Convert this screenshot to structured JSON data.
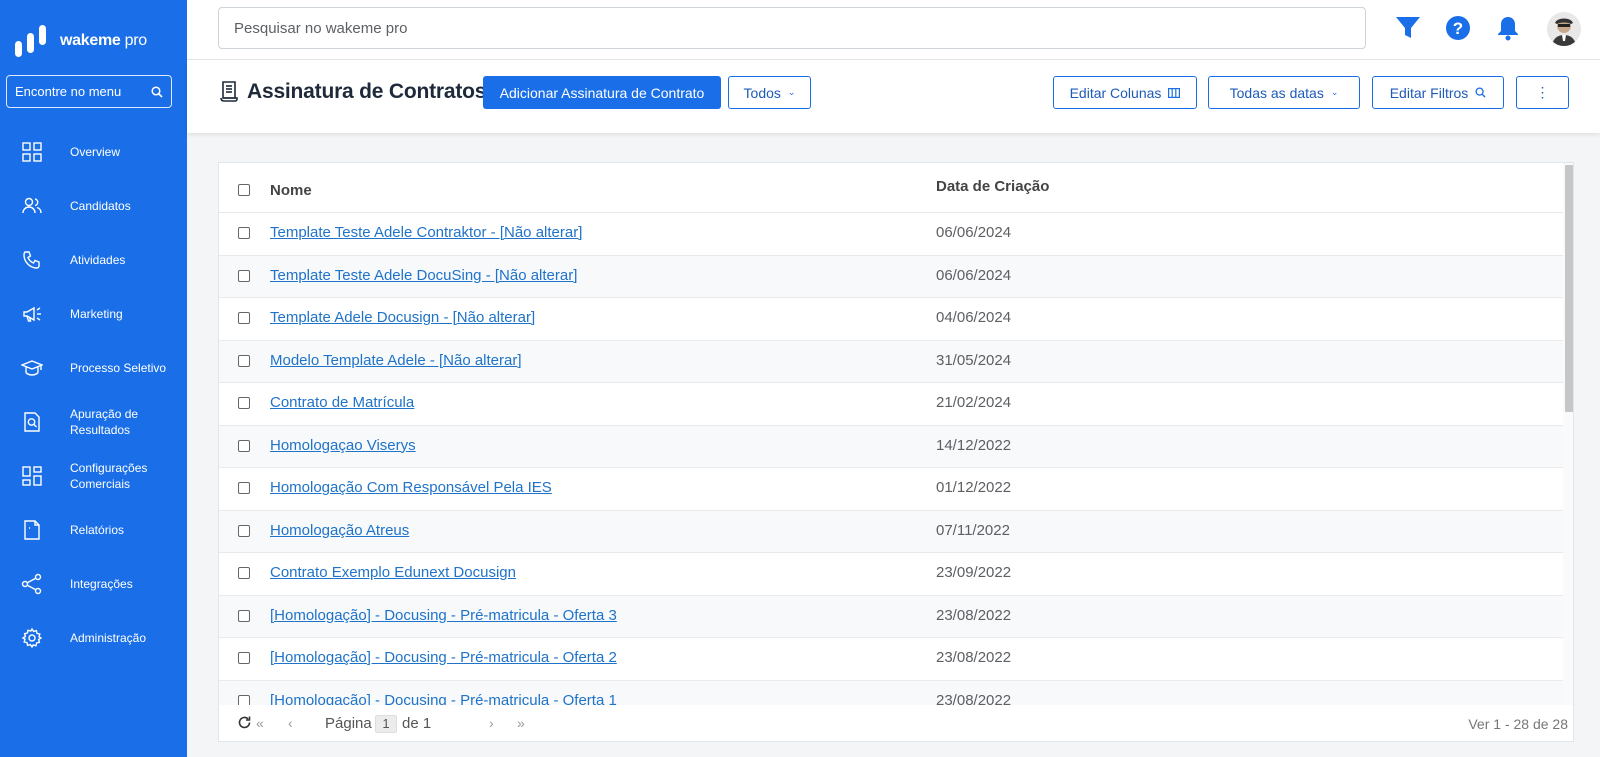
{
  "brand": {
    "name": "wakeme",
    "suffix": "pro"
  },
  "menu_search": {
    "placeholder": "Encontre no menu"
  },
  "sidebar": {
    "items": [
      {
        "label": "Overview",
        "icon": "grid-icon"
      },
      {
        "label": "Candidatos",
        "icon": "users-icon"
      },
      {
        "label": "Atividades",
        "icon": "phone-icon"
      },
      {
        "label": "Marketing",
        "icon": "megaphone-icon"
      },
      {
        "label": "Processo Seletivo",
        "icon": "graduation-cap-icon"
      },
      {
        "label": "Apuração de Resultados",
        "icon": "document-search-icon"
      },
      {
        "label": "Configurações Comerciais",
        "icon": "grid-icon"
      },
      {
        "label": "Relatórios",
        "icon": "report-icon"
      },
      {
        "label": "Integrações",
        "icon": "share-icon"
      },
      {
        "label": "Administração",
        "icon": "gear-icon"
      }
    ]
  },
  "topbar": {
    "search_placeholder": "Pesquisar no wakeme pro",
    "icons": [
      "filter-icon",
      "help-icon",
      "bell-icon",
      "avatar"
    ]
  },
  "header": {
    "title": "Assinatura de Contratos",
    "add_button": "Adicionar Assinatura de Contrato",
    "filter_select": "Todos",
    "edit_columns": "Editar Colunas",
    "date_filter": "Todas as datas",
    "edit_filters": "Editar Filtros",
    "more": "⋮"
  },
  "table": {
    "columns": {
      "name": "Nome",
      "date": "Data de Criação"
    },
    "rows": [
      {
        "name": "Template Teste Adele Contraktor - [Não alterar]",
        "date": "06/06/2024"
      },
      {
        "name": "Template Teste Adele DocuSing - [Não alterar]",
        "date": "06/06/2024"
      },
      {
        "name": "Template Adele Docusign - [Não alterar]",
        "date": "04/06/2024"
      },
      {
        "name": "Modelo Template Adele - [Não alterar]",
        "date": "31/05/2024"
      },
      {
        "name": "Contrato de Matrícula",
        "date": "21/02/2024"
      },
      {
        "name": "Homologaçao Viserys",
        "date": "14/12/2022"
      },
      {
        "name": "Homologação Com Responsável Pela IES",
        "date": "01/12/2022"
      },
      {
        "name": "Homologação Atreus",
        "date": "07/11/2022"
      },
      {
        "name": "Contrato Exemplo Edunext Docusign",
        "date": "23/09/2022"
      },
      {
        "name": "[Homologação] - Docusing - Pré-matricula - Oferta 3",
        "date": "23/08/2022"
      },
      {
        "name": "[Homologação] - Docusing - Pré-matricula - Oferta 2",
        "date": "23/08/2022"
      },
      {
        "name": "[Homologação] - Docusing - Pré-matricula - Oferta 1",
        "date": "23/08/2022"
      }
    ]
  },
  "pagination": {
    "label": "Página",
    "current": "1",
    "of": "de 1",
    "count": "Ver 1 - 28 de 28"
  },
  "colors": {
    "primary": "#1a6fe8",
    "link": "#1f73c9",
    "sidebar": "#1a6fe8"
  }
}
